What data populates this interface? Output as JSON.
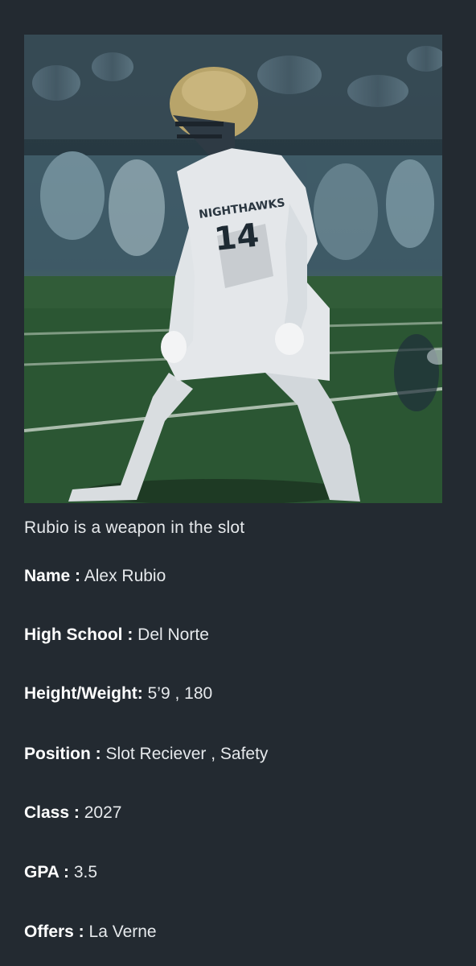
{
  "photo": {
    "alt_icon": "football-player-photo",
    "jersey_text": "NIGHTHAWKS",
    "jersey_number": "14"
  },
  "caption": "Rubio is a weapon in the slot",
  "profile": [
    {
      "label": "Name :",
      "value": "Alex Rubio"
    },
    {
      "label": "High School :",
      "value": "Del Norte"
    },
    {
      "label": "Height/Weight:",
      "value": "5’9 , 180"
    },
    {
      "label": "Position :",
      "value": "Slot Reciever , Safety"
    },
    {
      "label": "Class :",
      "value": "2027"
    },
    {
      "label": "GPA :",
      "value": "3.5"
    },
    {
      "label": "Offers :",
      "value": "La Verne"
    }
  ]
}
